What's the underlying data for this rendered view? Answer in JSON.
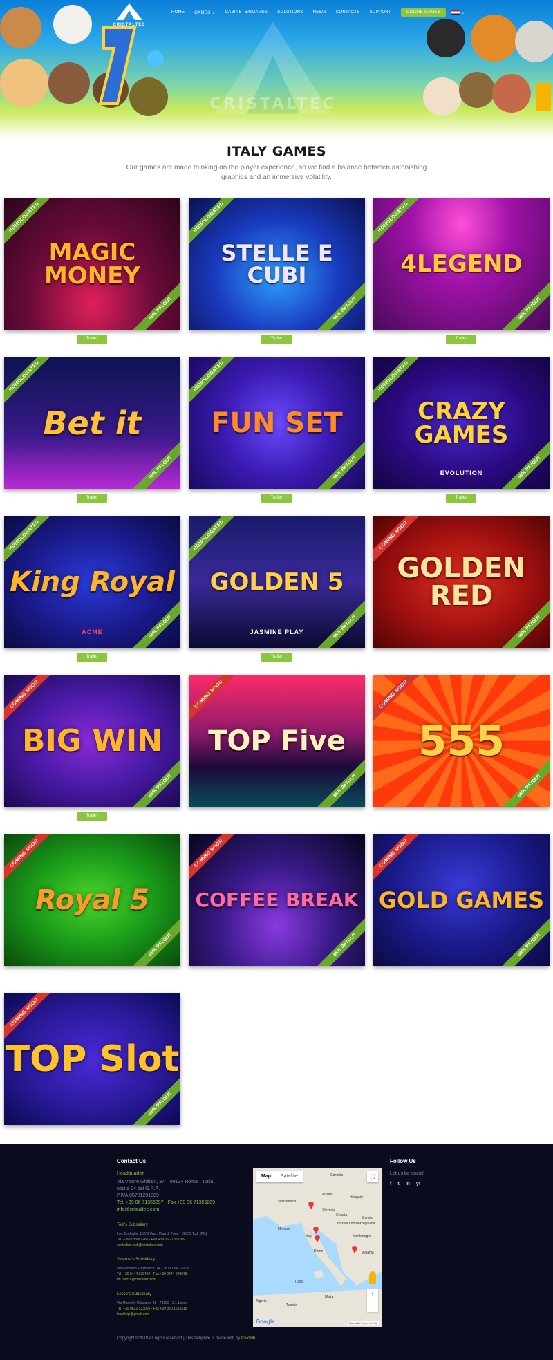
{
  "brand": {
    "name": "CRISTALTEC",
    "watermark": "CRISTALTEC"
  },
  "nav": {
    "items": [
      "HOME",
      "GAMES",
      "CABINETS/BOARDS",
      "SOLUTIONS",
      "NEWS",
      "CONTACTS",
      "SUPPORT"
    ],
    "games_caret": "⌄",
    "cta": "ONLINE GAMES",
    "lang_caret": "⌄"
  },
  "intro": {
    "title": "ITALY GAMES",
    "text": "Our games are made thinking on the player experience, so we find a balance between astonishing graphics and an immersive volatility."
  },
  "games": [
    {
      "title": "MAGIC MONEY",
      "badge": "HOMOLOGATED",
      "payout": "68% PAYOUT",
      "trailer": "Trailer"
    },
    {
      "title": "STELLE E CUBI",
      "badge": "HOMOLOGATED",
      "payout": "68% PAYOUT",
      "trailer": "Trailer"
    },
    {
      "title": "4LEGEND",
      "badge": "HOMOLOGATED",
      "payout": "68% PAYOUT",
      "trailer": "Trailer"
    },
    {
      "title": "Bet it",
      "badge": "HOMOLOGATED",
      "payout": "68% PAYOUT",
      "trailer": "Trailer"
    },
    {
      "title": "FUN SET",
      "badge": "HOMOLOGATED",
      "payout": "68% PAYOUT",
      "trailer": "Trailer"
    },
    {
      "title": "CRAZY GAMES",
      "sub": "EVOLUTION",
      "badge": "HOMOLOGATED",
      "payout": "68% PAYOUT",
      "trailer": "Trailer"
    },
    {
      "title": "King Royal",
      "sub": "ACME",
      "badge": "HOMOLOGATED",
      "payout": "68% PAYOUT",
      "trailer": "Trailer"
    },
    {
      "title": "GOLDEN 5",
      "sub": "JASMINE PLAY",
      "badge": "HOMOLOGATED",
      "payout": "68% PAYOUT",
      "trailer": "Trailer"
    },
    {
      "title": "GOLDEN RED",
      "badge": "COMING SOON",
      "payout": "68% PAYOUT"
    },
    {
      "title": "BIG WIN",
      "badge": "COMING SOON",
      "payout": "68% PAYOUT",
      "trailer": "Trailer"
    },
    {
      "title": "TOP Five",
      "badge": "COMING SOON",
      "payout": "68% PAYOUT"
    },
    {
      "title": "555",
      "badge": "COMING SOON",
      "payout": "68% PAYOUT"
    },
    {
      "title": "Royal 5",
      "badge": "COMING SOON",
      "payout": "68% PAYOUT"
    },
    {
      "title": "COFFEE BREAK",
      "badge": "COMING SOON",
      "payout": "68% PAYOUT"
    },
    {
      "title": "GOLD GAMES",
      "badge": "COMING SOON",
      "payout": "68% PAYOUT"
    },
    {
      "title": "TOP Slot",
      "badge": "COMING SOON",
      "payout": "68% PAYOUT"
    }
  ],
  "footer": {
    "contact_title": "Contact Us",
    "hq_title": "Headquarter",
    "hq_lines": [
      "Via Vittore Ghiliani, 37 – 00134 Roma – Italia",
      "uscita 24 del G.R.A.",
      "P.IVA 05781291009"
    ],
    "hq_phone": "Tel. +39 06 71356397 - Fax +39 06 71356289",
    "hq_email": "info@cristaltec.com",
    "subsidiaries": [
      {
        "title": "Todi's Subsidiary",
        "address": "Loc. Bodoglie, 162/G Fraz. Pian di Porto - 06059 Todi (PG)",
        "phone": "Tel. +390758987266 - Fax +39 06 71356289",
        "email": "centralino.todi@cristaltec.com"
      },
      {
        "title": "Vicenza's Subsidiary",
        "address": "Via Girolamo Frigimelica, 14 - 36100 VICENZA",
        "phone": "Tel. +39 0444 926492 - Fax +39 0444 920978",
        "email": "tm.piazza@cristaltec.com"
      },
      {
        "title": "Lecce's Subsidiary",
        "address": "Via Marcello Chiatante 28 - 73100 - Z.I. Lecce",
        "phone": "Tel. +39 0832 333066 - Fax +39 330 1013319",
        "email": "leacifuigi@gmail.com"
      }
    ],
    "copyright": "Copyright ©2019 All rights reserved | This template is made with by ",
    "copyright_link": "Colorlib",
    "follow_title": "Follow Us",
    "follow_tag": "Let us be social",
    "social": [
      "f",
      "t",
      "in",
      "yt"
    ],
    "map": {
      "tab_map": "Map",
      "tab_satellite": "Satellite",
      "google": "Google",
      "terms": "Map data  Terms of Use",
      "cities": [
        "Czechia",
        "Austria",
        "Hungary",
        "Switzerland",
        "Slovenia",
        "Croatia",
        "Bosnia and Herzegovina",
        "Serbia",
        "Montenegro",
        "Monaco",
        "Italy",
        "Rome",
        "Albania",
        "Tunis",
        "Malta",
        "Tunisia",
        "Algeria"
      ]
    }
  },
  "colors": {
    "accent": "#8cc63f",
    "footer_bg": "#0b0b1e",
    "coming_soon": "#d8342c",
    "homologated": "#6aa82a"
  }
}
